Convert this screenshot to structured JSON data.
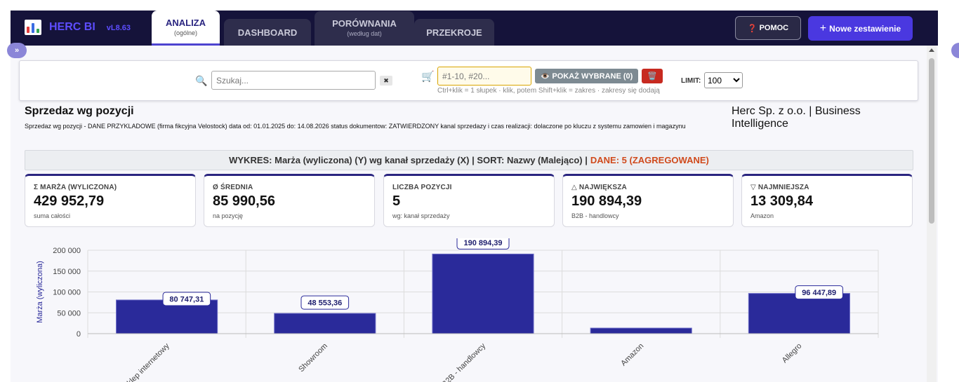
{
  "app": {
    "name": "HERC BI",
    "version": "vL8.63",
    "tabs": [
      {
        "label": "ANALIZA",
        "sub": "(ogólne)"
      },
      {
        "label": "DASHBOARD",
        "sub": ""
      },
      {
        "label": "PORÓWNANIA",
        "sub": "(według dat)"
      },
      {
        "label": "PRZEKROJE",
        "sub": ""
      }
    ],
    "help_label": "POMOC",
    "new_label": "Nowe zestawienie",
    "collapse_label": "»"
  },
  "filters": {
    "search_placeholder": "Szukaj...",
    "clear_label": "✖",
    "selection_placeholder": "#1-10, #20...",
    "show_selected_label": "POKAŻ WYBRANE (0)",
    "hint": "Ctrl+klik = 1 słupek · klik, potem Shift+klik = zakres · zakresy się dodają",
    "limit_label": "LIMIT:",
    "limit_value": "100"
  },
  "report": {
    "title": "Sprzedaz wg pozycji",
    "description": "Sprzedaz wg pozycji - DANE PRZYKLADOWE (firma fikcyjna Velostock) data od: 01.01.2025 do: 14.08.2026 status dokumentow: ZATWIERDZONY kanal sprzedazy i czas realizacji: dolaczone po kluczu z systemu zamowien i magazynu",
    "company": "Herc Sp. z o.o. | Business Intelligence",
    "banner": "WYKRES: Marża (wyliczona) (Y) wg kanał sprzedaży (X) | SORT: Nazwy (Malejąco) |",
    "banner_dane": "DANE: 5 (ZAGREGOWANE)"
  },
  "kpis": [
    {
      "label": "Σ MARŻA (WYLICZONA)",
      "value": "429 952,79",
      "sub": "suma całości"
    },
    {
      "label": "Ø ŚREDNIA",
      "value": "85 990,56",
      "sub": "na pozycję"
    },
    {
      "label": "LICZBA POZYCJI",
      "value": "5",
      "sub": "wg: kanał sprzedaży"
    },
    {
      "label": "△ NAJWIĘKSZA",
      "value": "190 894,39",
      "sub": "B2B - handlowcy"
    },
    {
      "label": "▽ NAJMNIEJSZA",
      "value": "13 309,84",
      "sub": "Amazon"
    }
  ],
  "chart_data": {
    "type": "bar",
    "categories": [
      "Sklep internetowy",
      "Showroom",
      "B2B - handlowcy",
      "Amazon",
      "Allegro"
    ],
    "values": [
      80747.31,
      48553.36,
      190894.39,
      13309.84,
      96447.89
    ],
    "data_labels": [
      "80 747,31",
      "48 553,36",
      "190 894,39",
      "",
      "96 447,89"
    ],
    "ylabel": "Marża (wyliczona)",
    "ylim": [
      0,
      200000
    ],
    "yticks": [
      "0",
      "50 000",
      "100 000",
      "150 000",
      "200 000"
    ],
    "grid": true,
    "color": "#2a2a9a"
  }
}
